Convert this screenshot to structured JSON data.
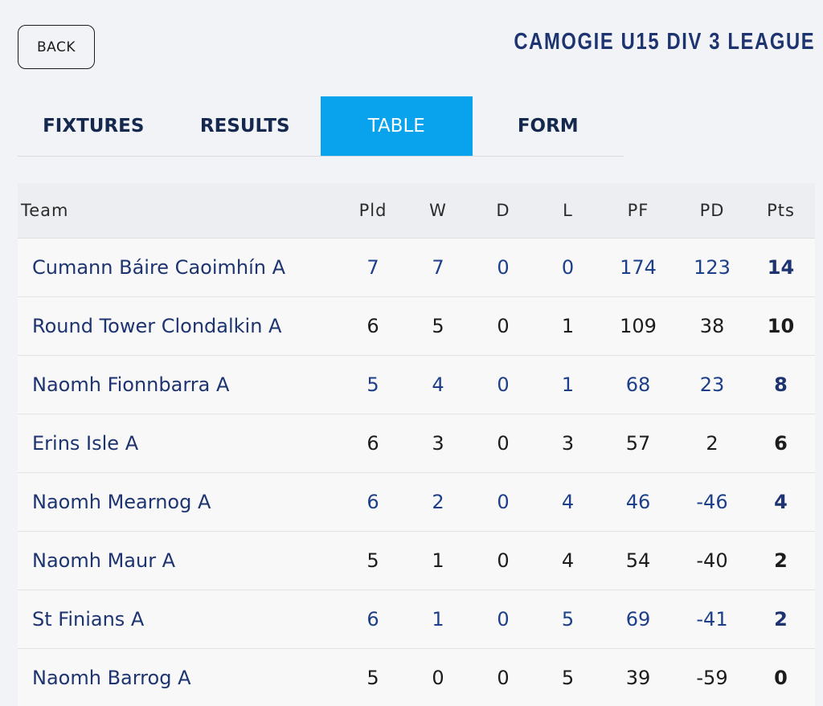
{
  "back_label": "BACK",
  "league_title": "CAMOGIE U15 DIV 3 LEAGUE",
  "tabs": [
    {
      "label": "FIXTURES",
      "active": false
    },
    {
      "label": "RESULTS",
      "active": false
    },
    {
      "label": "TABLE",
      "active": true
    },
    {
      "label": "FORM",
      "active": false
    }
  ],
  "colors": {
    "accent": "#08a3ec",
    "title": "#1d3470",
    "link_number": "#1d3f8a"
  },
  "table": {
    "headers": [
      "Team",
      "Pld",
      "W",
      "D",
      "L",
      "PF",
      "PD",
      "Pts"
    ],
    "rows": [
      {
        "team": "Cumann Báire Caoimhín A",
        "pld": "7",
        "w": "7",
        "d": "0",
        "l": "0",
        "pf": "174",
        "pd": "123",
        "pts": "14"
      },
      {
        "team": "Round Tower Clondalkin A",
        "pld": "6",
        "w": "5",
        "d": "0",
        "l": "1",
        "pf": "109",
        "pd": "38",
        "pts": "10"
      },
      {
        "team": "Naomh Fionnbarra A",
        "pld": "5",
        "w": "4",
        "d": "0",
        "l": "1",
        "pf": "68",
        "pd": "23",
        "pts": "8"
      },
      {
        "team": "Erins Isle A",
        "pld": "6",
        "w": "3",
        "d": "0",
        "l": "3",
        "pf": "57",
        "pd": "2",
        "pts": "6"
      },
      {
        "team": "Naomh Mearnog A",
        "pld": "6",
        "w": "2",
        "d": "0",
        "l": "4",
        "pf": "46",
        "pd": "-46",
        "pts": "4"
      },
      {
        "team": "Naomh Maur A",
        "pld": "5",
        "w": "1",
        "d": "0",
        "l": "4",
        "pf": "54",
        "pd": "-40",
        "pts": "2"
      },
      {
        "team": "St Finians A",
        "pld": "6",
        "w": "1",
        "d": "0",
        "l": "5",
        "pf": "69",
        "pd": "-41",
        "pts": "2"
      },
      {
        "team": "Naomh Barrog A",
        "pld": "5",
        "w": "0",
        "d": "0",
        "l": "5",
        "pf": "39",
        "pd": "-59",
        "pts": "0"
      }
    ]
  }
}
